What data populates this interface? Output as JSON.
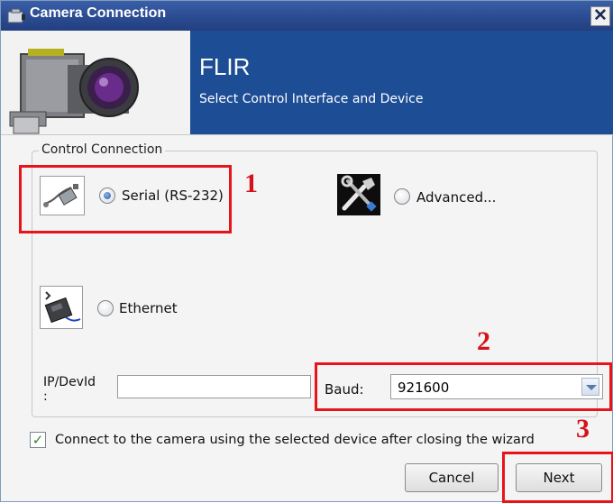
{
  "window": {
    "title": "Camera Connection",
    "close_symbol": "✕"
  },
  "banner": {
    "title": "FLIR",
    "subtitle": "Select Control Interface and Device"
  },
  "control_connection": {
    "group_label": "Control Connection",
    "options": [
      {
        "label": "Serial (RS-232)",
        "selected": true,
        "icon": "serial-cable-icon"
      },
      {
        "label": "Advanced...",
        "selected": false,
        "icon": "tools-icon"
      },
      {
        "label": "Ethernet",
        "selected": false,
        "icon": "ethernet-adapter-icon"
      }
    ],
    "ip_label": "IP/DevId\n:",
    "ip_value": "",
    "baud_label": "Baud:",
    "baud_value": "921600"
  },
  "connect_checkbox": {
    "checked": true,
    "label": "Connect to the camera using the selected device after closing the wizard"
  },
  "buttons": {
    "cancel": "Cancel",
    "next": "Next"
  },
  "annotations": [
    "1",
    "2",
    "3"
  ],
  "colors": {
    "banner_bg": "#1d4d95",
    "annotation_red": "#e8141a",
    "title_bar": "#2c4d93"
  }
}
